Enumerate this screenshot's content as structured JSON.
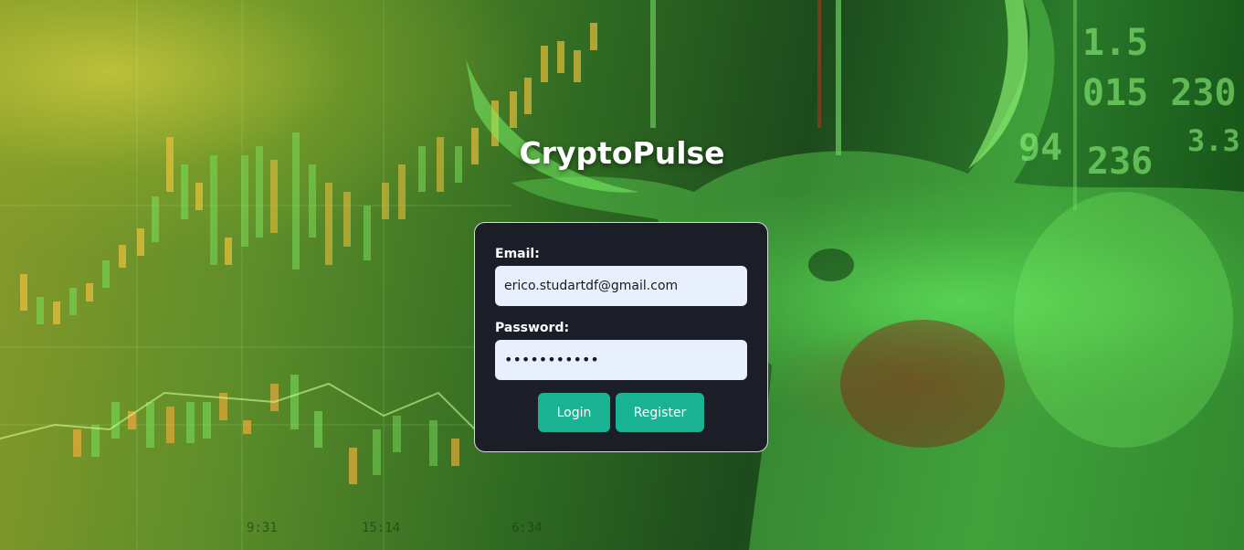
{
  "app": {
    "title": "CryptoPulse"
  },
  "login_form": {
    "email_label": "Email:",
    "email_value": "erico.studartdf@gmail.com",
    "password_label": "Password:",
    "password_value": "•••••••••••",
    "login_label": "Login",
    "register_label": "Register"
  },
  "background": {
    "ticker_1": "1.5",
    "ticker_2": "015 230",
    "ticker_3": "236",
    "ticker_4": "94",
    "ticker_5": "3.3",
    "axis_1": "9:31",
    "axis_2": "15:14",
    "axis_3": "6:34"
  },
  "colors": {
    "card_background": "#1b1d27",
    "input_background": "#e8f0fe",
    "button_color": "#19b394",
    "title_color": "#ffffff"
  }
}
